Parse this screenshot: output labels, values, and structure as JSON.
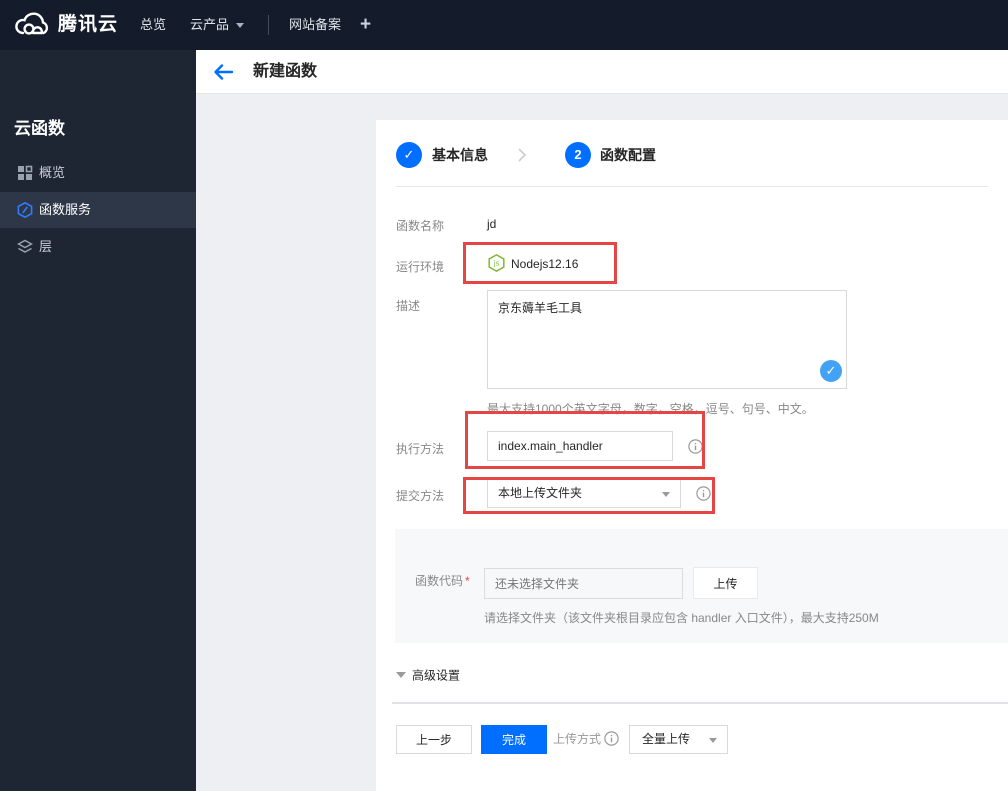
{
  "topbar": {
    "brand": "腾讯云",
    "nav": [
      {
        "label": "总览"
      },
      {
        "label": "云产品"
      },
      {
        "label": "网站备案"
      },
      {
        "label": "+"
      }
    ]
  },
  "sidebar": {
    "title": "云函数",
    "items": [
      {
        "label": "概览",
        "icon": "grid-icon",
        "active": false
      },
      {
        "label": "函数服务",
        "icon": "scf-hexagon-icon",
        "active": true
      },
      {
        "label": "层",
        "icon": "layers-icon",
        "active": false
      }
    ]
  },
  "header": {
    "title": "新建函数"
  },
  "steps": {
    "step1_label": "基本信息",
    "step1_state": "done",
    "step2_num": "2",
    "step2_label": "函数配置"
  },
  "form": {
    "name_label": "函数名称",
    "name_value": "jd",
    "runtime_label": "运行环境",
    "runtime_value": "Nodejs12.16",
    "desc_label": "描述",
    "desc_value": "京东薅羊毛工具",
    "desc_hint": "最大支持1000个英文字母，数字，空格，逗号、句号、中文。",
    "handler_label": "执行方法",
    "handler_value": "index.main_handler",
    "submit_label": "提交方法",
    "submit_value": "本地上传文件夹"
  },
  "code_section": {
    "label": "函数代码",
    "required_mark": "*",
    "placeholder": "还未选择文件夹",
    "upload_button": "上传",
    "hint": "请选择文件夹（该文件夹根目录应包含 handler 入口文件），最大支持250M"
  },
  "advanced": {
    "label": "高级设置"
  },
  "footer": {
    "prev_button": "上一步",
    "finish_button": "完成",
    "upload_mode_label": "上传方式",
    "upload_mode_value": "全量上传"
  },
  "icons": {
    "check": "✓"
  },
  "colors": {
    "accent_blue": "#006eff",
    "annotation_red": "#e54545",
    "node_green": "#7fb832",
    "badge_blue": "#42a2f5",
    "topbar_bg": "#141c2b",
    "sidebar_bg": "#1e2634"
  }
}
